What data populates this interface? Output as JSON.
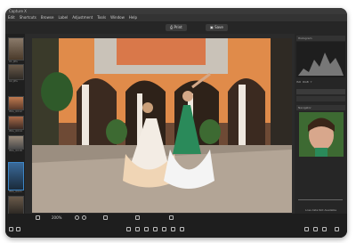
{
  "window": {
    "title": "Capture X"
  },
  "menu": [
    "Edit",
    "Shortcuts",
    "Browse",
    "Label",
    "Adjustment",
    "Tools",
    "Window",
    "Help"
  ],
  "toolbar": {
    "print_label": "Print",
    "save_label": "Save"
  },
  "filmstrip": {
    "labels": [
      "01.JPG",
      "02.JPG",
      "IMG_0012",
      "IMG_0014",
      "IMG_0016",
      "IMG_0021",
      "IMG_0024"
    ]
  },
  "right_panel": {
    "histogram_title": "Histogram",
    "tabs": [
      "ISO",
      "RGB",
      "Y"
    ],
    "navigator_title": "Navigator",
    "status": "Loss data  Not Available"
  },
  "bottom": {
    "zoom": "200%"
  },
  "colors": {
    "accent": "#3d86c6",
    "panel": "#262626",
    "bg": "#2b2b2b"
  }
}
